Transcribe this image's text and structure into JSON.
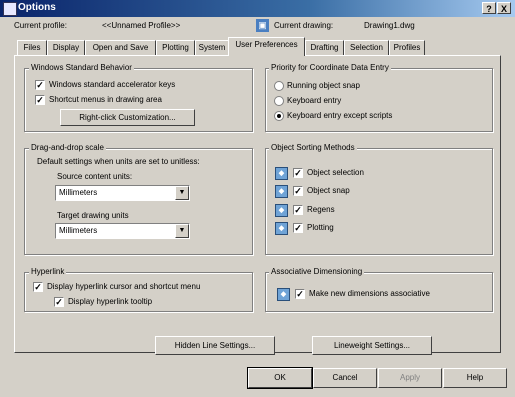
{
  "window": {
    "title": "Options",
    "help_label": "?",
    "close_label": "X"
  },
  "header": {
    "profile_label": "Current profile:",
    "profile_value": "<<Unnamed Profile>>",
    "drawing_label": "Current drawing:",
    "drawing_value": "Drawing1.dwg"
  },
  "tabs": [
    {
      "label": "Files"
    },
    {
      "label": "Display"
    },
    {
      "label": "Open and Save"
    },
    {
      "label": "Plotting"
    },
    {
      "label": "System"
    },
    {
      "label": "User Preferences",
      "active": true
    },
    {
      "label": "Drafting"
    },
    {
      "label": "Selection"
    },
    {
      "label": "Profiles"
    }
  ],
  "windows_behavior": {
    "title": "Windows Standard Behavior",
    "accelerator_label": "Windows standard accelerator keys",
    "accelerator_checked": true,
    "shortcut_label": "Shortcut menus in drawing area",
    "shortcut_checked": true,
    "customize_button": "Right-click Customization..."
  },
  "dragdrop": {
    "title": "Drag-and-drop scale",
    "desc": "Default settings when units are set to unitless:",
    "source_label": "Source content units:",
    "source_value": "Millimeters",
    "target_label": "Target drawing units",
    "target_value": "Millimeters"
  },
  "hyperlink": {
    "title": "Hyperlink",
    "cursor_label": "Display hyperlink cursor and shortcut menu",
    "cursor_checked": true,
    "tooltip_label": "Display hyperlink tooltip",
    "tooltip_checked": true
  },
  "priority": {
    "title": "Priority for Coordinate Data Entry",
    "options": [
      {
        "label": "Running object snap",
        "selected": false
      },
      {
        "label": "Keyboard entry",
        "selected": false
      },
      {
        "label": "Keyboard entry except scripts",
        "selected": true
      }
    ]
  },
  "object_sorting": {
    "title": "Object Sorting Methods",
    "items": [
      {
        "label": "Object selection",
        "checked": true
      },
      {
        "label": "Object snap",
        "checked": true
      },
      {
        "label": "Regens",
        "checked": true
      },
      {
        "label": "Plotting",
        "checked": true
      }
    ]
  },
  "associative": {
    "title": "Associative Dimensioning",
    "label": "Make new dimensions associative",
    "checked": true
  },
  "panel_buttons": {
    "hidden_line": "Hidden Line Settings...",
    "lineweight": "Lineweight Settings..."
  },
  "footer": {
    "ok": "OK",
    "cancel": "Cancel",
    "apply": "Apply",
    "help": "Help"
  },
  "glyphs": {
    "check": "✓",
    "dropdown": "▼",
    "drawing_icon": "▣",
    "obj_icon": "◆"
  }
}
